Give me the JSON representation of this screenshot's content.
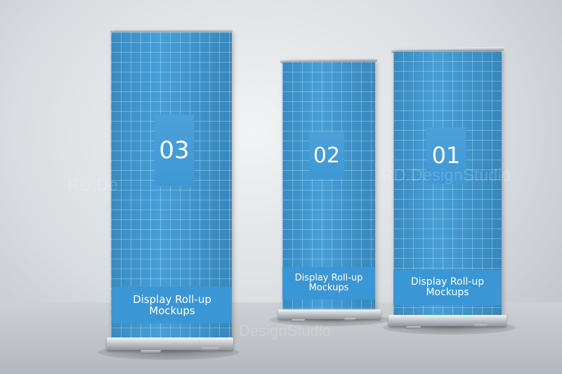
{
  "banners": [
    {
      "number": "03",
      "caption_line1": "Display Roll-up",
      "caption_line2": "Mockups"
    },
    {
      "number": "02",
      "caption_line1": "Display Roll-up",
      "caption_line2": "Mockups"
    },
    {
      "number": "01",
      "caption_line1": "Display Roll-up",
      "caption_line2": "Mockups"
    }
  ],
  "watermarks": [
    "RD.De",
    "RD.DesignStudio",
    "DesignStudio"
  ],
  "colors": {
    "banner_blue": "#3d9ad6",
    "text": "#ffffff",
    "background": "#d9dde1"
  }
}
